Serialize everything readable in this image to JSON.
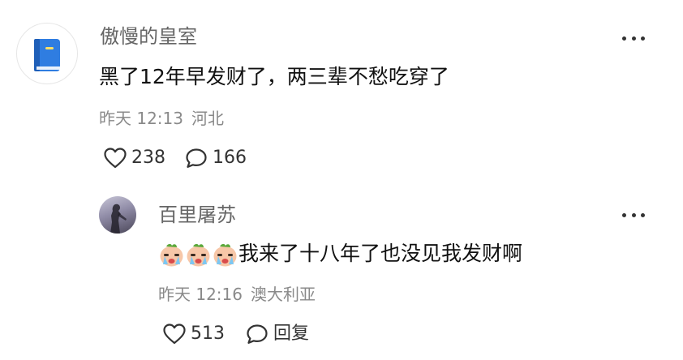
{
  "comments": [
    {
      "username": "傲慢的皇室",
      "avatar": "book-icon",
      "text": "黑了12年早发财了，两三辈不愁吃穿了",
      "time": "昨天 12:13",
      "location": "河北",
      "likes": "238",
      "replies": "166"
    }
  ],
  "reply": {
    "username": "百里屠苏",
    "avatar": "photo-avatar",
    "emojis": [
      "crying-face-emoji",
      "crying-face-emoji",
      "crying-face-emoji"
    ],
    "text": "我来了十八年了也没见我发财啊",
    "time": "昨天 12:16",
    "location": "澳大利亚",
    "likes": "513",
    "reply_label": "回复"
  },
  "colors": {
    "avatar_book": "#2f7de1",
    "muted_text": "#8a8a8a",
    "username_text": "#666666"
  }
}
